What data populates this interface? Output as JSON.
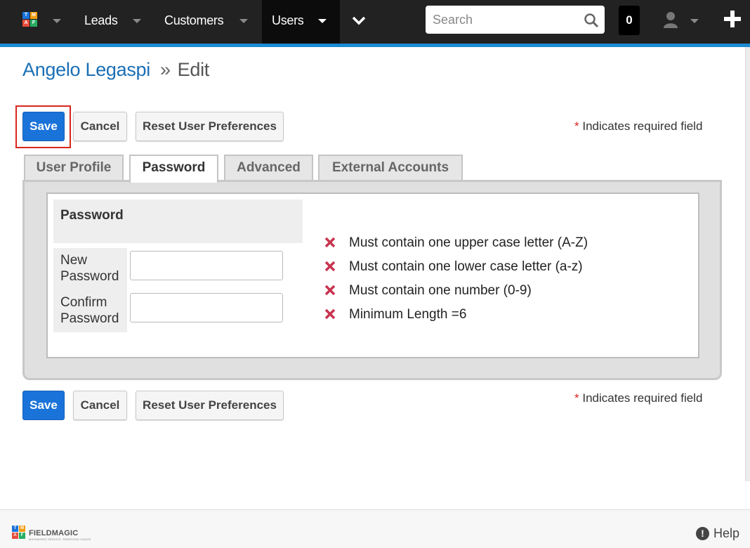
{
  "colors": {
    "nav_bg": "#222222",
    "nav_active_bg": "#0c0c0c",
    "accent_stripe": "#1b8bd3",
    "primary_button": "#1a73d9",
    "link_blue": "#1a6fb5",
    "error_x": "#c8334d",
    "required_star": "#dd2222"
  },
  "nav": {
    "logo_letters": [
      "T",
      "M",
      "A",
      "F"
    ],
    "items": [
      {
        "label": "Leads"
      },
      {
        "label": "Customers"
      },
      {
        "label": "Users"
      }
    ],
    "search": {
      "placeholder": "Search",
      "value": "",
      "icon": "search-icon"
    },
    "notification_count": "0",
    "user_icon": "user-icon",
    "add_icon": "plus-icon"
  },
  "header": {
    "record_name": "Angelo Legaspi",
    "separator": "»",
    "action": "Edit"
  },
  "toolbar": {
    "save_label": "Save",
    "cancel_label": "Cancel",
    "reset_label": "Reset User Preferences",
    "required_marker": "*",
    "required_note": "Indicates required field"
  },
  "tabs": [
    {
      "label": "User Profile",
      "active": false
    },
    {
      "label": "Password",
      "active": true
    },
    {
      "label": "Advanced",
      "active": false
    },
    {
      "label": "External Accounts",
      "active": false
    }
  ],
  "password_panel": {
    "title": "Password",
    "fields": [
      {
        "label_line1": "New",
        "label_line2": "Password",
        "value": ""
      },
      {
        "label_line1": "Confirm",
        "label_line2": "Password",
        "value": ""
      }
    ],
    "rules": [
      {
        "text": "Must contain one upper case letter (A-Z)",
        "status": "unmet",
        "icon": "x-icon"
      },
      {
        "text": "Must contain one lower case letter (a-z)",
        "status": "unmet",
        "icon": "x-icon"
      },
      {
        "text": "Must contain one number (0-9)",
        "status": "unmet",
        "icon": "x-icon"
      },
      {
        "text": "Minimum Length =6",
        "status": "unmet",
        "icon": "x-icon"
      }
    ]
  },
  "footer": {
    "logo_letters": [
      "T",
      "M",
      "A",
      "F"
    ],
    "brand": "FIELDMAGIC",
    "tagline": "MAXIMIZING SERVICE, REMOVING CHAOS",
    "help_label": "Help"
  }
}
